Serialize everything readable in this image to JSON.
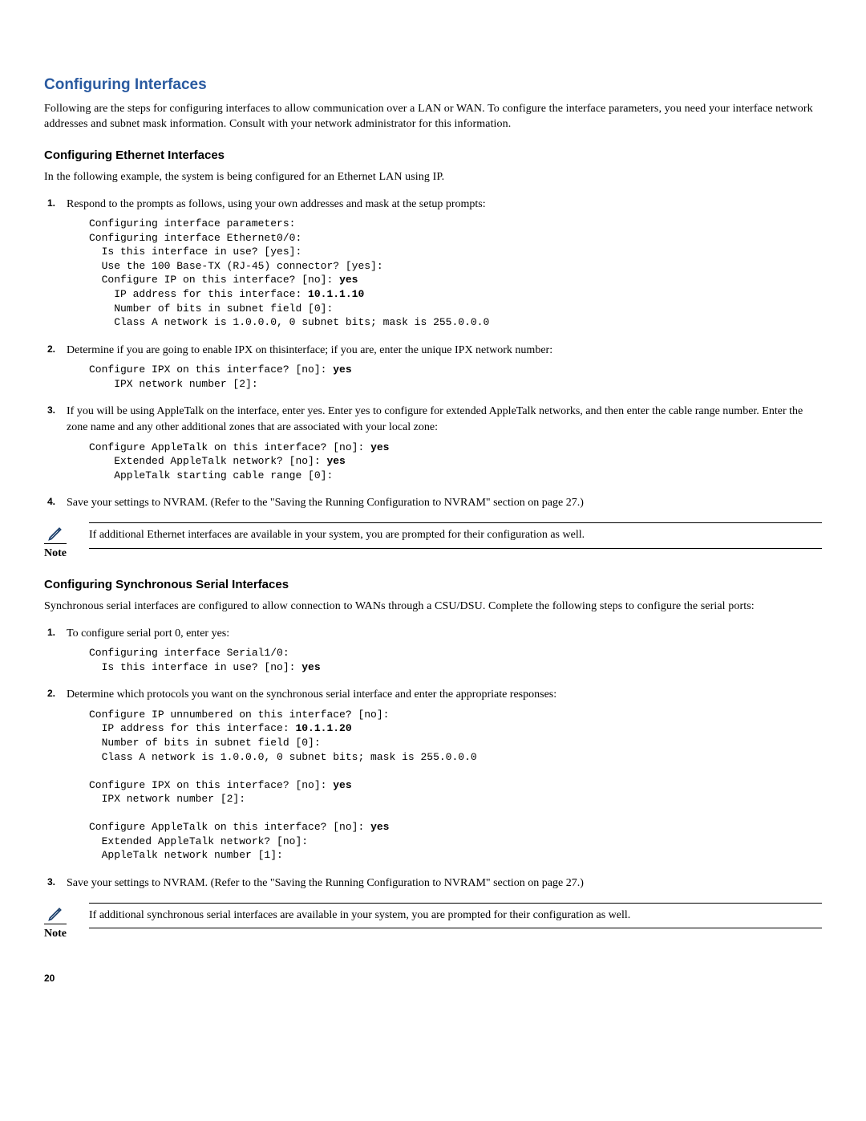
{
  "h2": "Configuring Interfaces",
  "intro": "Following are the steps for configuring interfaces to allow communication over a LAN or WAN. To configure the interface parameters, you need your interface network addresses and subnet mask information. Consult with your network administrator for this information.",
  "eth": {
    "heading": "Configuring Ethernet Interfaces",
    "intro": "In the following example, the system is being configured for an Ethernet LAN using IP.",
    "step1": "Respond to the prompts as follows, using your own addresses and mask at the setup prompts:",
    "code1_l1": "Configuring interface parameters:",
    "code1_l2": "Configuring interface Ethernet0/0:",
    "code1_l3": "  Is this interface in use? [yes]:",
    "code1_l4": "  Use the 100 Base-TX (RJ-45) connector? [yes]:",
    "code1_l5a": "  Configure IP on this interface? [no]: ",
    "code1_l5b": "yes",
    "code1_l6a": "    IP address for this interface: ",
    "code1_l6b": "10.1.1.10",
    "code1_l7": "    Number of bits in subnet field [0]:",
    "code1_l8": "    Class A network is 1.0.0.0, 0 subnet bits; mask is 255.0.0.0",
    "step2": "Determine if you are going to enable IPX on thisinterface; if you are, enter the unique IPX network number:",
    "code2_l1a": "Configure IPX on this interface? [no]: ",
    "code2_l1b": "yes",
    "code2_l2": "    IPX network number [2]:",
    "step3": "If you will be using AppleTalk on the interface, enter yes. Enter yes to configure for extended AppleTalk networks, and then enter the cable range number. Enter the zone name and any other additional zones that are associated with your local zone:",
    "code3_l1a": "Configure AppleTalk on this interface? [no]: ",
    "code3_l1b": "yes",
    "code3_l2a": "    Extended AppleTalk network? [no]: ",
    "code3_l2b": "yes",
    "code3_l3": "    AppleTalk starting cable range [0]:",
    "step4": "Save your settings to NVRAM. (Refer to the \"Saving the Running Configuration to NVRAM\" section on page 27.)",
    "note_label": "Note",
    "note_text": "If additional Ethernet interfaces are available in your system, you are prompted for their configuration as well."
  },
  "ser": {
    "heading": "Configuring Synchronous Serial Interfaces",
    "intro": "Synchronous serial interfaces are configured to allow connection to WANs through a CSU/DSU. Complete the following steps to configure the serial ports:",
    "step1": "To configure serial port 0, enter yes:",
    "code1_l1": "Configuring interface Serial1/0:",
    "code1_l2a": "  Is this interface in use? [no]: ",
    "code1_l2b": "yes",
    "step2": "Determine which protocols you want on the synchronous serial interface and enter the appropriate responses:",
    "code2_l1": "Configure IP unnumbered on this interface? [no]:",
    "code2_l2a": "  IP address for this interface: ",
    "code2_l2b": "10.1.1.20",
    "code2_l3": "  Number of bits in subnet field [0]:",
    "code2_l4": "  Class A network is 1.0.0.0, 0 subnet bits; mask is 255.0.0.0",
    "code2_blank1": "",
    "code2_l5a": "Configure IPX on this interface? [no]: ",
    "code2_l5b": "yes",
    "code2_l6": "  IPX network number [2]:",
    "code2_blank2": "",
    "code2_l7a": "Configure AppleTalk on this interface? [no]: ",
    "code2_l7b": "yes",
    "code2_l8": "  Extended AppleTalk network? [no]:",
    "code2_l9": "  AppleTalk network number [1]:",
    "step3": "Save your settings to NVRAM. (Refer to the \"Saving the Running Configuration to NVRAM\" section on page 27.)",
    "note_label": "Note",
    "note_text": "If additional synchronous serial interfaces are available in your system, you are prompted for their configuration as well."
  },
  "page_number": "20"
}
